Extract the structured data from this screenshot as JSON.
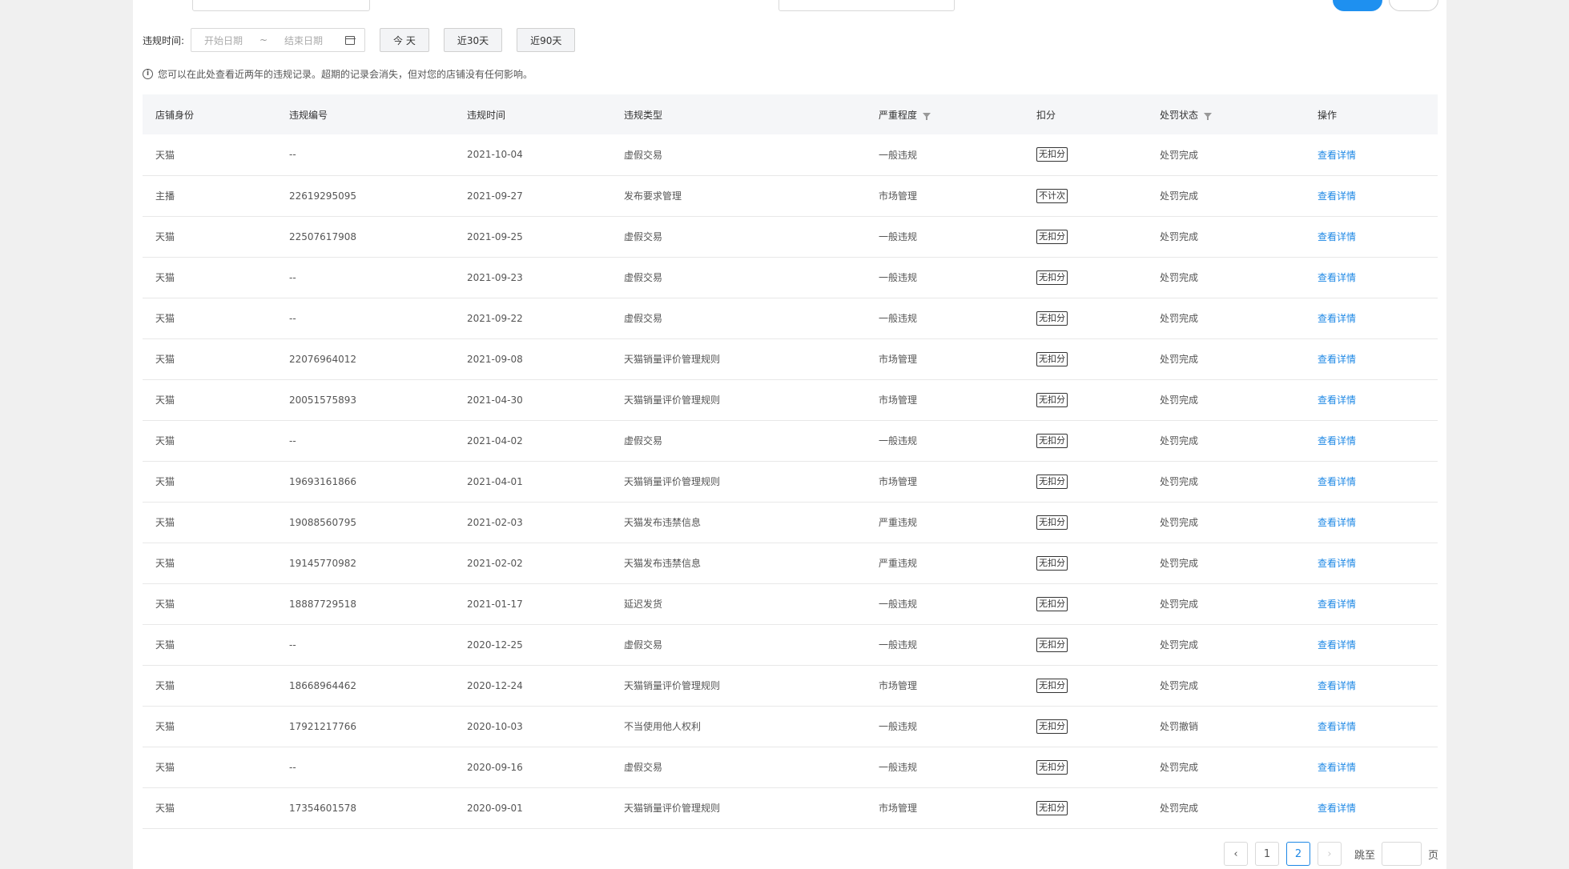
{
  "filters": {
    "date_label": "违规时间:",
    "start_placeholder": "开始日期",
    "separator": "~",
    "end_placeholder": "结束日期",
    "quick": [
      "今 天",
      "近30天",
      "近90天"
    ]
  },
  "notice": "您可以在此处查看近两年的违规记录。超期的记录会消失，但对您的店铺没有任何影响。",
  "table": {
    "headers": [
      "店铺身份",
      "违规编号",
      "违规时间",
      "违规类型",
      "严重程度",
      "扣分",
      "处罚状态",
      "操作"
    ],
    "rows": [
      {
        "shop": "天猫",
        "id": "--",
        "date": "2021-10-04",
        "type": "虚假交易",
        "severity": "一般违规",
        "score": "无扣分",
        "status": "处罚完成",
        "action": "查看详情"
      },
      {
        "shop": "主播",
        "id": "22619295095",
        "date": "2021-09-27",
        "type": "发布要求管理",
        "severity": "市场管理",
        "score": "不计次",
        "status": "处罚完成",
        "action": "查看详情"
      },
      {
        "shop": "天猫",
        "id": "22507617908",
        "date": "2021-09-25",
        "type": "虚假交易",
        "severity": "一般违规",
        "score": "无扣分",
        "status": "处罚完成",
        "action": "查看详情"
      },
      {
        "shop": "天猫",
        "id": "--",
        "date": "2021-09-23",
        "type": "虚假交易",
        "severity": "一般违规",
        "score": "无扣分",
        "status": "处罚完成",
        "action": "查看详情"
      },
      {
        "shop": "天猫",
        "id": "--",
        "date": "2021-09-22",
        "type": "虚假交易",
        "severity": "一般违规",
        "score": "无扣分",
        "status": "处罚完成",
        "action": "查看详情"
      },
      {
        "shop": "天猫",
        "id": "22076964012",
        "date": "2021-09-08",
        "type": "天猫销量评价管理规则",
        "severity": "市场管理",
        "score": "无扣分",
        "status": "处罚完成",
        "action": "查看详情"
      },
      {
        "shop": "天猫",
        "id": "20051575893",
        "date": "2021-04-30",
        "type": "天猫销量评价管理规则",
        "severity": "市场管理",
        "score": "无扣分",
        "status": "处罚完成",
        "action": "查看详情"
      },
      {
        "shop": "天猫",
        "id": "--",
        "date": "2021-04-02",
        "type": "虚假交易",
        "severity": "一般违规",
        "score": "无扣分",
        "status": "处罚完成",
        "action": "查看详情"
      },
      {
        "shop": "天猫",
        "id": "19693161866",
        "date": "2021-04-01",
        "type": "天猫销量评价管理规则",
        "severity": "市场管理",
        "score": "无扣分",
        "status": "处罚完成",
        "action": "查看详情"
      },
      {
        "shop": "天猫",
        "id": "19088560795",
        "date": "2021-02-03",
        "type": "天猫发布违禁信息",
        "severity": "严重违规",
        "score": "无扣分",
        "status": "处罚完成",
        "action": "查看详情"
      },
      {
        "shop": "天猫",
        "id": "19145770982",
        "date": "2021-02-02",
        "type": "天猫发布违禁信息",
        "severity": "严重违规",
        "score": "无扣分",
        "status": "处罚完成",
        "action": "查看详情"
      },
      {
        "shop": "天猫",
        "id": "18887729518",
        "date": "2021-01-17",
        "type": "延迟发货",
        "severity": "一般违规",
        "score": "无扣分",
        "status": "处罚完成",
        "action": "查看详情"
      },
      {
        "shop": "天猫",
        "id": "--",
        "date": "2020-12-25",
        "type": "虚假交易",
        "severity": "一般违规",
        "score": "无扣分",
        "status": "处罚完成",
        "action": "查看详情"
      },
      {
        "shop": "天猫",
        "id": "18668964462",
        "date": "2020-12-24",
        "type": "天猫销量评价管理规则",
        "severity": "市场管理",
        "score": "无扣分",
        "status": "处罚完成",
        "action": "查看详情"
      },
      {
        "shop": "天猫",
        "id": "17921217766",
        "date": "2020-10-03",
        "type": "不当使用他人权利",
        "severity": "一般违规",
        "score": "无扣分",
        "status": "处罚撤销",
        "action": "查看详情"
      },
      {
        "shop": "天猫",
        "id": "--",
        "date": "2020-09-16",
        "type": "虚假交易",
        "severity": "一般违规",
        "score": "无扣分",
        "status": "处罚完成",
        "action": "查看详情"
      },
      {
        "shop": "天猫",
        "id": "17354601578",
        "date": "2020-09-01",
        "type": "天猫销量评价管理规则",
        "severity": "市场管理",
        "score": "无扣分",
        "status": "处罚完成",
        "action": "查看详情"
      }
    ]
  },
  "pagination": {
    "prev": "‹",
    "pages": [
      "1",
      "2"
    ],
    "current": "2",
    "next": "›",
    "jump_label": "跳至",
    "page_suffix": "页"
  }
}
